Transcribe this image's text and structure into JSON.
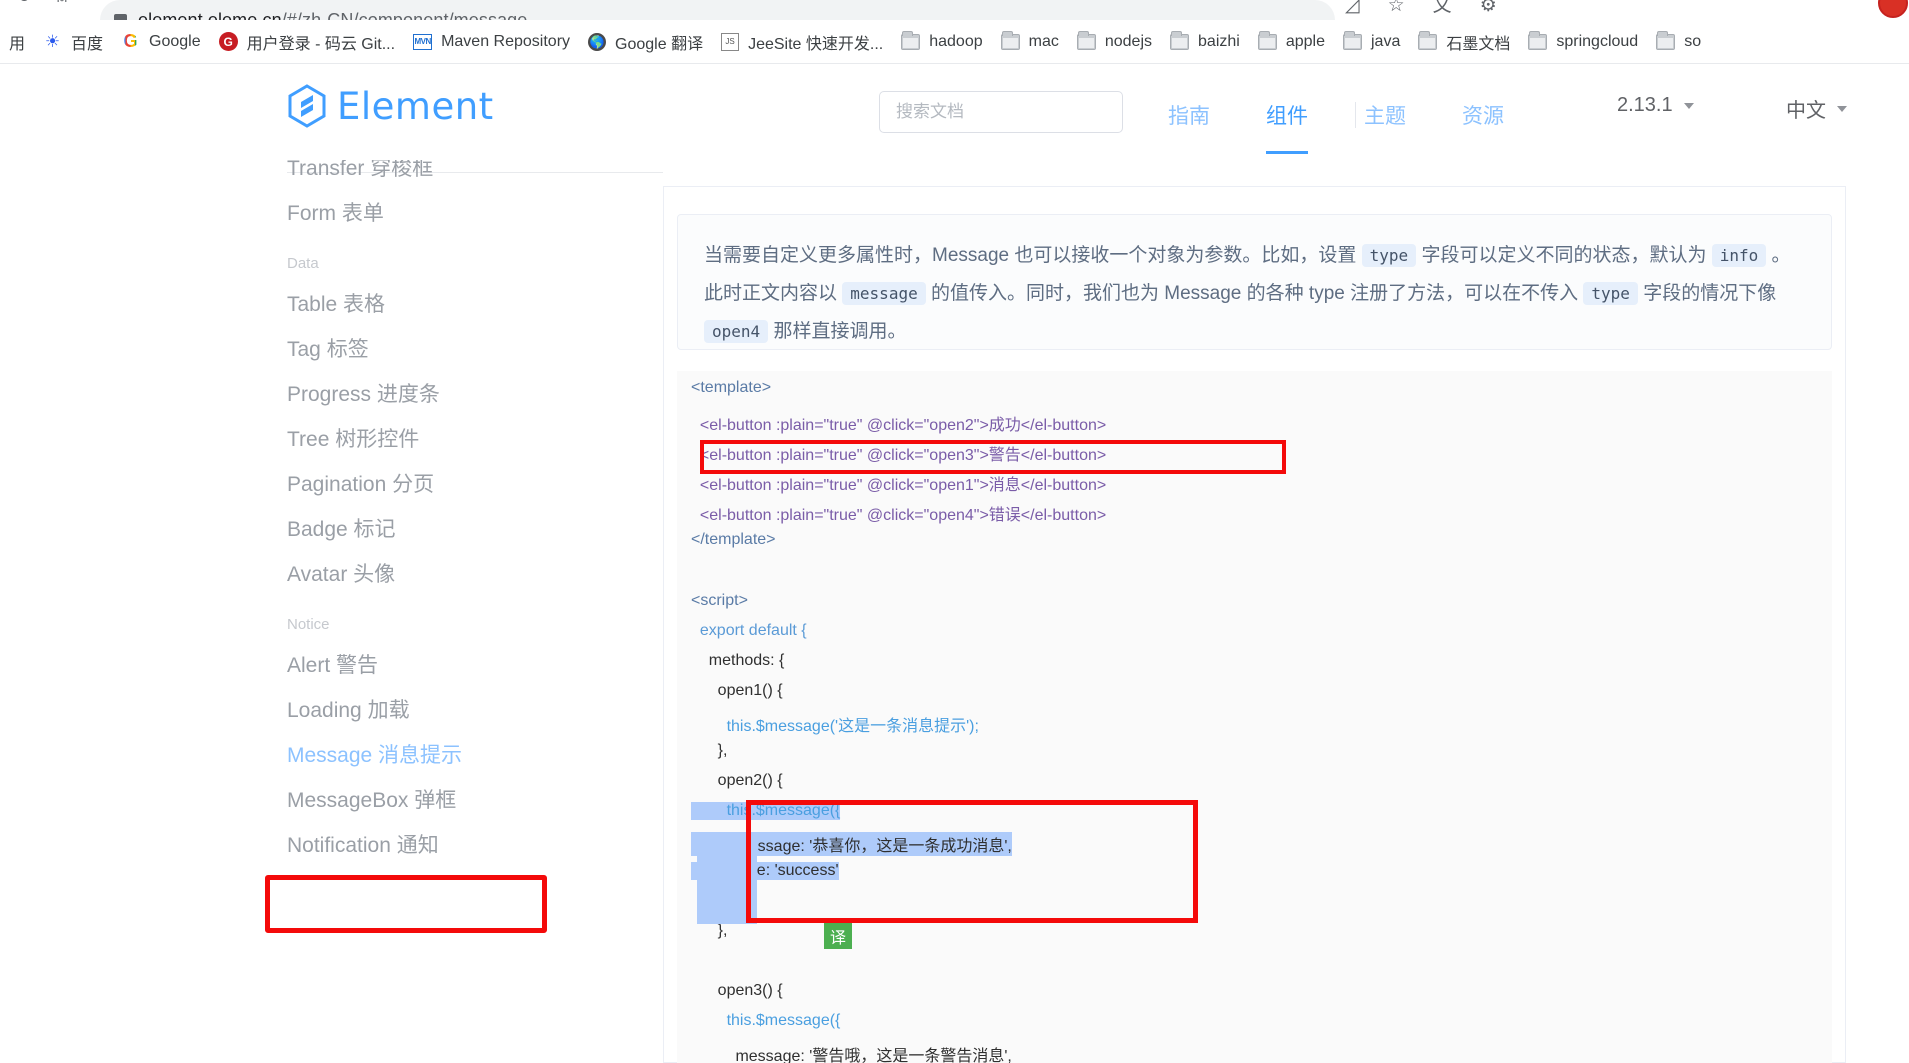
{
  "browser": {
    "url_host": "element.eleme.cn",
    "url_path": "/#/zh-CN/component/message",
    "lock_icon": "lock-icon",
    "reload_icon": "reload-icon",
    "share_icon": "share-icon",
    "cast_icon": "cast-icon",
    "bookmark_star_icon": "star-icon",
    "translate_icon": "translate-icon",
    "extension_icon": "puzzle-icon",
    "profile_icon": "profile-avatar",
    "bookmarks": [
      {
        "label": "用",
        "icon": "partial-bookmark"
      },
      {
        "label": "百度",
        "icon": "baidu-icon"
      },
      {
        "label": "Google",
        "icon": "google-icon"
      },
      {
        "label": "用户登录 - 码云 Git...",
        "icon": "gitee-icon"
      },
      {
        "label": "Maven Repository",
        "icon": "maven-icon"
      },
      {
        "label": "Google 翻译",
        "icon": "globe-icon"
      },
      {
        "label": "JeeSite 快速开发...",
        "icon": "jeesite-icon"
      },
      {
        "label": "hadoop",
        "icon": "folder-icon"
      },
      {
        "label": "mac",
        "icon": "folder-icon"
      },
      {
        "label": "nodejs",
        "icon": "folder-icon"
      },
      {
        "label": "baizhi",
        "icon": "folder-icon"
      },
      {
        "label": "apple",
        "icon": "folder-icon"
      },
      {
        "label": "java",
        "icon": "folder-icon"
      },
      {
        "label": "石墨文档",
        "icon": "folder-icon"
      },
      {
        "label": "springcloud",
        "icon": "folder-icon"
      },
      {
        "label": "so",
        "icon": "folder-icon"
      }
    ]
  },
  "site_header": {
    "logo_text": "Element",
    "search_placeholder": "搜索文档",
    "search_value": "",
    "nav": [
      {
        "label": "指南",
        "active": false
      },
      {
        "label": "组件",
        "active": true
      },
      {
        "label": "主题",
        "active": false
      },
      {
        "label": "资源",
        "active": false
      }
    ],
    "version": "2.13.1",
    "language": "中文"
  },
  "sidebar": {
    "items": [
      {
        "label": "Transfer 穿梭框",
        "type": "item",
        "active": false
      },
      {
        "label": "Form 表单",
        "type": "item",
        "active": false
      },
      {
        "label": "Data",
        "type": "group"
      },
      {
        "label": "Table 表格",
        "type": "item",
        "active": false
      },
      {
        "label": "Tag 标签",
        "type": "item",
        "active": false
      },
      {
        "label": "Progress 进度条",
        "type": "item",
        "active": false
      },
      {
        "label": "Tree 树形控件",
        "type": "item",
        "active": false
      },
      {
        "label": "Pagination 分页",
        "type": "item",
        "active": false
      },
      {
        "label": "Badge 标记",
        "type": "item",
        "active": false
      },
      {
        "label": "Avatar 头像",
        "type": "item",
        "active": false
      },
      {
        "label": "Notice",
        "type": "group"
      },
      {
        "label": "Alert 警告",
        "type": "item",
        "active": false
      },
      {
        "label": "Loading 加载",
        "type": "item",
        "active": false
      },
      {
        "label": "Message 消息提示",
        "type": "item",
        "active": true
      },
      {
        "label": "MessageBox 弹框",
        "type": "item",
        "active": false
      },
      {
        "label": "Notification 通知",
        "type": "item",
        "active": false
      }
    ]
  },
  "main": {
    "description": {
      "line1_a": "当需要自定义更多属性时，Message 也可以接收一个对象为参数。比如，设置 ",
      "code_type_1": "type",
      "line1_b": " 字段可以定义不同的状态，默认为 ",
      "code_info": "info",
      "line1_c": " 。",
      "line2_a": "此时正文内容以 ",
      "code_message": "message",
      "line2_b": " 的值传入。同时，我们也为 Message 的各种 type 注册了方法，可以在不传入 ",
      "code_type_2": "type",
      "line2_c": " 字段的情况下像",
      "line3_a": "open4",
      "line3_b": " 那样直接调用。"
    },
    "code": {
      "l01": "<template>",
      "l02": "  <el-button :plain=\"true\" @click=\"open2\">成功</el-button>",
      "l03": "  <el-button :plain=\"true\" @click=\"open3\">警告</el-button>",
      "l04": "  <el-button :plain=\"true\" @click=\"open1\">消息</el-button>",
      "l05": "  <el-button :plain=\"true\" @click=\"open4\">错误</el-button>",
      "l06": "</template>",
      "l07": "<script>",
      "l08": "  export default {",
      "l09": "    methods: {",
      "l10": "      open1() {",
      "l11": "        this.$message('这是一条消息提示');",
      "l12": "      },",
      "l13": "      open2() {",
      "l14": "        this.$message({",
      "l15": "          message: '恭喜你，这是一条成功消息',",
      "l16": "          type: 'success'",
      "l17": "        });",
      "l18": "      },",
      "l19": "      open3() {",
      "l20": "        this.$message({",
      "l21": "          message: '警告哦，这是一条警告消息',"
    },
    "annotations": {
      "translate_badge": "译"
    }
  },
  "colors": {
    "accent_blue": "#409eff",
    "annotation_red": "#f40a0a",
    "selection_blue": "#aecbfa",
    "translate_green": "#4caf50",
    "code_bg": "#fafafa"
  }
}
